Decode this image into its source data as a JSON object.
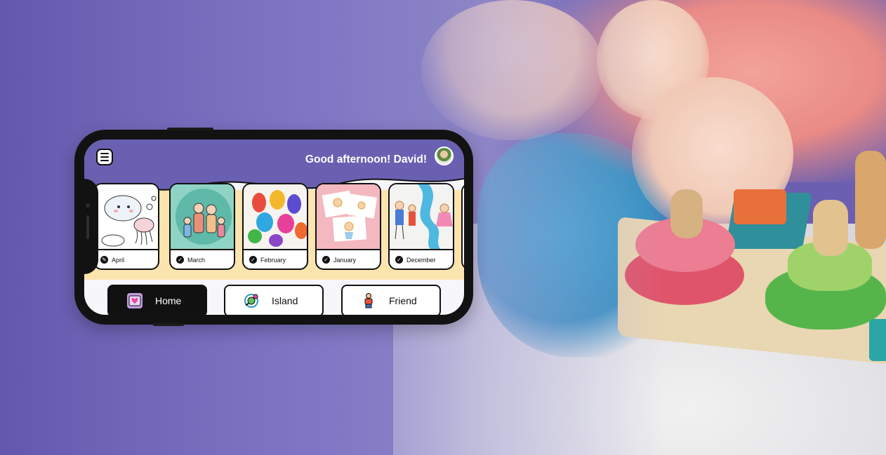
{
  "greeting": "Good afternoon! David!",
  "cards": [
    {
      "label": "April"
    },
    {
      "label": "March"
    },
    {
      "label": "February"
    },
    {
      "label": "January"
    },
    {
      "label": "December"
    }
  ],
  "nav": {
    "home": "Home",
    "island": "Island",
    "friend": "Friend"
  },
  "colors": {
    "header": "#6a60b1",
    "band": "#fbe4ad",
    "background": "#6a5fb0"
  }
}
